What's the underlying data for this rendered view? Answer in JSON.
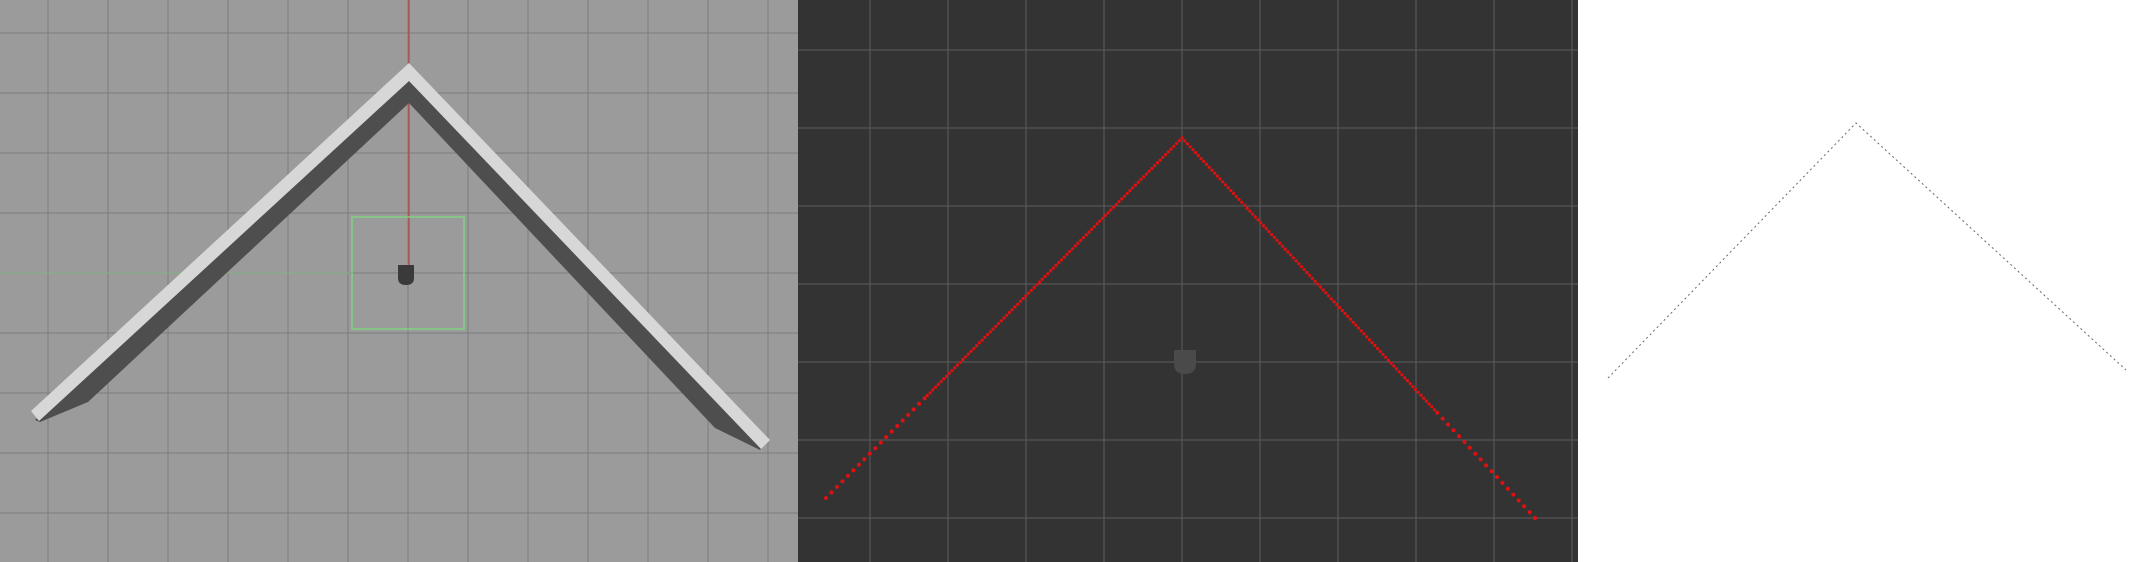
{
  "viewports": [
    {
      "mode": "shaded",
      "colors": {
        "background": "#9b9b9b",
        "grid": "#7c7c7c",
        "axis_vertical": "#c8413d",
        "axis_horizontal": "#7fb27f",
        "geometry_face": "#d7d7d7",
        "geometry_shadow": "#4e4e4e",
        "selection_box": "#7fd47f",
        "pivot": "#3a3a3a"
      }
    },
    {
      "mode": "points",
      "colors": {
        "background": "#333333",
        "grid": "#5c5c5c",
        "points": "#e01010",
        "pivot": "#4a4a4a"
      }
    },
    {
      "mode": "outline",
      "colors": {
        "background": "#ffffff",
        "edges": "#6a6a6a"
      }
    }
  ]
}
